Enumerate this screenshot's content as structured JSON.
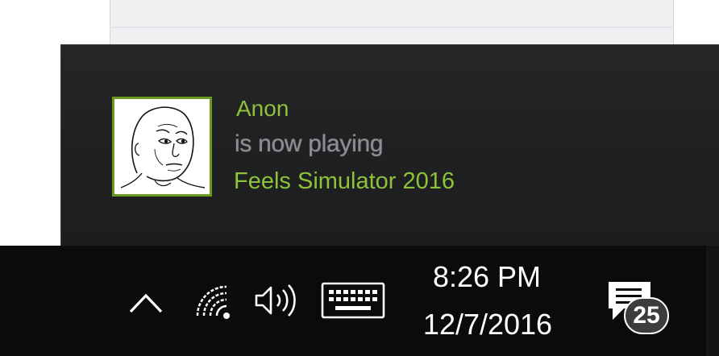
{
  "notification": {
    "user_name": "Anon",
    "status_text": "is now playing",
    "game_name": "Feels Simulator 2016",
    "avatar_icon": "wojak-face-avatar",
    "accent_color": "#8dc23a",
    "status_color": "#8d8e91",
    "background_color": "#1f2022"
  },
  "taskbar": {
    "icons": [
      "chevron-up-icon",
      "wifi-icon",
      "volume-icon",
      "keyboard-icon",
      "action-center-icon"
    ],
    "time": "8:26 PM",
    "date": "12/7/2016",
    "notification_count": "25",
    "background_color": "#0b0b0c"
  }
}
